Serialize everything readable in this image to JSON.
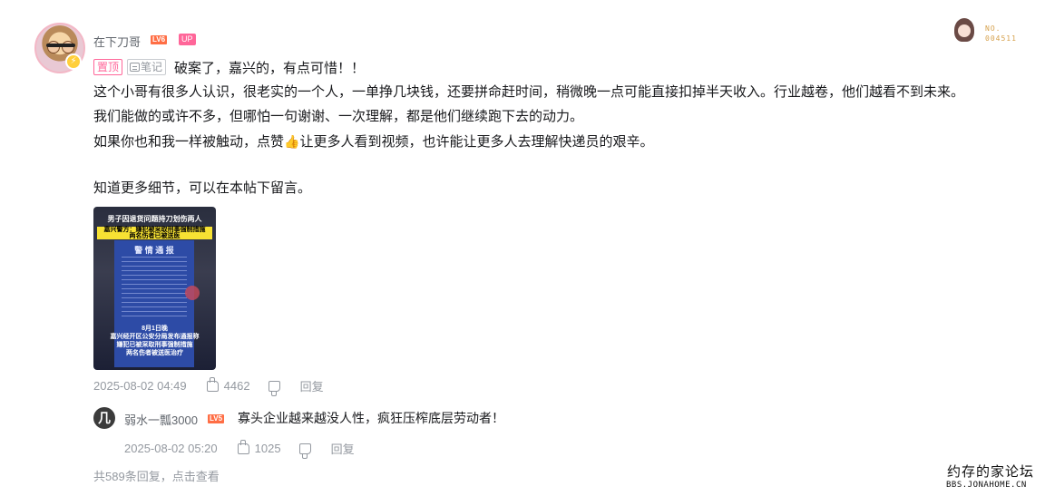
{
  "comment": {
    "username": "在下刀哥",
    "level_badge": "LV6",
    "up_badge": "UP",
    "decoration_number": "NO.\n004511",
    "tags": {
      "pinned": "置顶",
      "note": "笔记"
    },
    "title": "破案了，嘉兴的，有点可惜！！",
    "lines": [
      "这个小哥有很多人认识，很老实的一个人，一单挣几块钱，还要拼命赶时间，稍微晚一点可能直接扣掉半天收入。行业越卷，他们越看不到未来。",
      "我们能做的或许不多，但哪怕一句谢谢、一次理解，都是他们继续跑下去的动力。"
    ],
    "line3_before": "如果你也和我一样被触动，点赞",
    "line3_emoji": "👍",
    "line3_after": "让更多人看到视频，也许能让更多人去理解快递员的艰辛。",
    "line4": "知道更多细节，可以在本帖下留言。",
    "image": {
      "headline": "男子因退货问题持刀划伤两人",
      "yellow_text": "嘉兴警方：嫌犯被采取刑事强制措施\n两名伤者已被送医",
      "doc_title": "警 情 通 报",
      "caption": "8月1日晚\n嘉兴经开区公安分局发布通报称\n嫌犯已被采取刑事强制措施\n两名伤者被送医治疗"
    },
    "time": "2025-08-02 04:49",
    "likes": "4462",
    "reply_label": "回复"
  },
  "sub_reply": {
    "avatar_glyph": "几",
    "username": "弱水一瓢3000",
    "level_badge": "LV5",
    "text": "寡头企业越来越没人性，疯狂压榨底层劳动者！",
    "time": "2025-08-02 05:20",
    "likes": "1025",
    "reply_label": "回复"
  },
  "more_replies": "共589条回复，点击查看",
  "watermark": {
    "line1": "约存的家论坛",
    "line2": "BBS.JONAHOME.CN"
  },
  "colors": {
    "pink": "#ff6699",
    "level_orange": "#ff6e45",
    "meta_gray": "#9499a0"
  }
}
